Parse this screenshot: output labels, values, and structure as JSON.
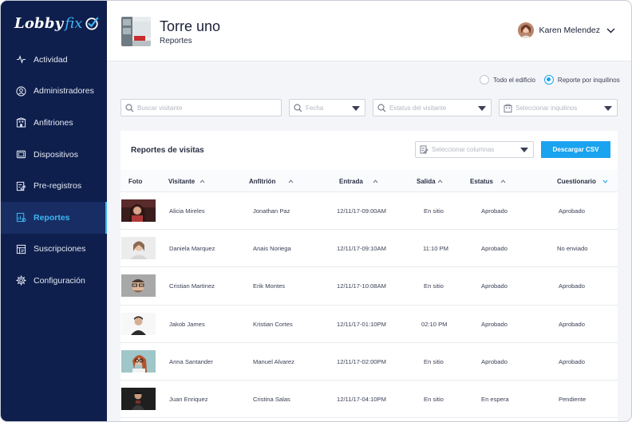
{
  "brand": {
    "part1": "Lobby",
    "part2": "fix"
  },
  "sidebar": {
    "items": [
      {
        "label": "Actividad",
        "icon": "activity-icon",
        "active": false
      },
      {
        "label": "Administradores",
        "icon": "user-circle-icon",
        "active": false
      },
      {
        "label": "Anfitriones",
        "icon": "building-icon",
        "active": false
      },
      {
        "label": "Dispositivos",
        "icon": "tablet-icon",
        "active": false
      },
      {
        "label": "Pre-registros",
        "icon": "edit-list-icon",
        "active": false
      },
      {
        "label": "Reportes",
        "icon": "report-icon",
        "active": true
      },
      {
        "label": "Suscripciones",
        "icon": "subscription-icon",
        "active": false
      },
      {
        "label": "Configuración",
        "icon": "gear-icon",
        "active": false
      }
    ]
  },
  "header": {
    "title": "Torre uno",
    "subtitle": "Reportes",
    "user_name": "Karen Melendez"
  },
  "view_options": {
    "building": "Todo el edificio",
    "tenants": "Reporte por inquilinos",
    "selected": "tenants"
  },
  "filters": {
    "visitor_placeholder": "Buscar visitante",
    "date_placeholder": "Fecha",
    "status_placeholder": "Estatus del visitante",
    "tenants_placeholder": "Seleccionar inquilinos"
  },
  "report": {
    "title": "Reportes de visitas",
    "columns_placeholder": "Seleccionar columnas",
    "csv_button": "Descargar CSV",
    "headers": {
      "photo": "Foto",
      "visitor": "Visitante",
      "host": "Anfitrión",
      "entry": "Entrada",
      "exit": "Salida",
      "status": "Estatus",
      "survey": "Cuestionario"
    },
    "rows": [
      {
        "visitor": "Alicia Mireles",
        "host": "Jonathan Paz",
        "entry": "12/11/17-09:00AM",
        "exit": "En sitio",
        "status": "Aprobado",
        "survey": "Aprobado"
      },
      {
        "visitor": "Daniela Marquez",
        "host": "Anais Noriega",
        "entry": "12/11/17-09:10AM",
        "exit": "11:10 PM",
        "status": "Aprobado",
        "survey": "No enviado"
      },
      {
        "visitor": "Cristian Martinez",
        "host": "Erik Montes",
        "entry": "12/11/17-10:08AM",
        "exit": "En sitio",
        "status": "Aprobado",
        "survey": "Aprobado"
      },
      {
        "visitor": "Jakob James",
        "host": "Kristian Cortes",
        "entry": "12/11/17-01:10PM",
        "exit": "02:10 PM",
        "status": "Aprobado",
        "survey": "Aprobado"
      },
      {
        "visitor": "Anna Santander",
        "host": "Manuel Alvarez",
        "entry": "12/11/17-02:00PM",
        "exit": "En sitio",
        "status": "Aprobado",
        "survey": "Aprobado"
      },
      {
        "visitor": "Juan Enriquez",
        "host": "Cristina Salas",
        "entry": "12/11/17-04:10PM",
        "exit": "En sitio",
        "status": "En espera",
        "survey": "Pendiente"
      }
    ]
  },
  "colors": {
    "sidebar": "#0e1f4d",
    "accent": "#1aa3ee",
    "active_nav": "#3fb6f5"
  }
}
